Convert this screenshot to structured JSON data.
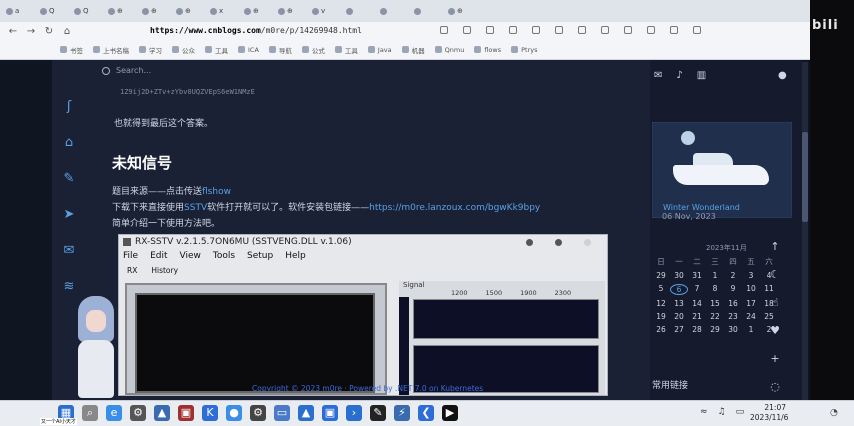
{
  "browser": {
    "tabs": [
      "a",
      "Q",
      "Q",
      "⊕",
      "⊕",
      "⊕",
      "x",
      "⊕",
      "⊕",
      "v",
      "",
      "",
      "",
      "⊕"
    ],
    "url_domain": "https://www.cnblogs.com",
    "url_path": "/m0re/p/14269948.html",
    "bookmarks": [
      "书签",
      "上书名稿",
      "学习",
      "公众",
      "工具",
      "ICA",
      "导航",
      "公式",
      "工具",
      "Java",
      "机器",
      "Qnmu",
      "flows",
      "Ptrys"
    ]
  },
  "site": {
    "search_placeholder": "Search...",
    "hash_line": "1Z9ij2D+ZTv+zYbv0UQZVEpS6eW1NMzE",
    "para1": "也就得到最后这个答案。",
    "heading": "未知信号",
    "para2_prefix": "题目来源——点击传送",
    "para2_link": "flshow",
    "para3_prefix": "下载下来直接使用",
    "para3_mid": "SSTV",
    "para3_text": "软件打开就可以了。软件安装包链接——",
    "para3_link": "https://m0re.lanzoux.com/bgwKk9bpy",
    "para4": "简单介绍一下使用方法吧。",
    "footer": "Copyright © 2023 m0re · Powered by .NET 7.0 on Kubernetes"
  },
  "sstv": {
    "title": "RX-SSTV v.2.1.5.7ON6MU (SSTVENG.DLL v.1.06)",
    "menu": [
      "File",
      "Edit",
      "View",
      "Tools",
      "Setup",
      "Help"
    ],
    "tools": [
      "RX",
      "History"
    ],
    "signal_label": "Signal",
    "ticks": [
      "1200",
      "1500",
      "1900",
      "2300"
    ]
  },
  "sidebar": {
    "card_title": "Winter Wonderland",
    "card_date": "06 Nov, 2023",
    "cal_header": "2023年11月",
    "weekdays": [
      "日",
      "一",
      "二",
      "三",
      "四",
      "五",
      "六"
    ],
    "days": [
      "29",
      "30",
      "31",
      "1",
      "2",
      "3",
      "4",
      "5",
      "6",
      "7",
      "8",
      "9",
      "10",
      "11",
      "12",
      "13",
      "14",
      "15",
      "16",
      "17",
      "18",
      "19",
      "20",
      "21",
      "22",
      "23",
      "24",
      "25",
      "26",
      "27",
      "28",
      "29",
      "30",
      "1",
      "2"
    ],
    "today": "6",
    "links_heading": "常用链接"
  },
  "right_logo": "bili",
  "taskbar": {
    "time": "21:07",
    "date": "2023/11/6",
    "caption": "又一个AI小天才"
  }
}
